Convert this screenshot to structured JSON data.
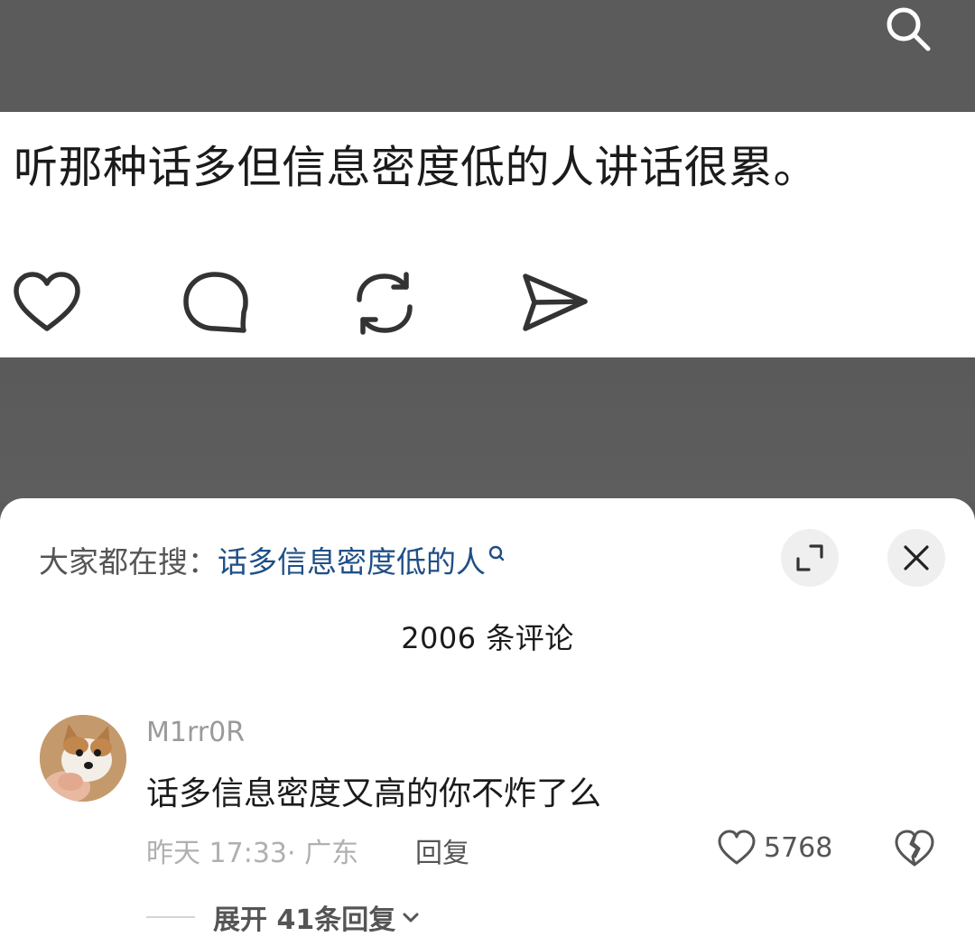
{
  "topbar": {
    "search_icon": "search-icon"
  },
  "post": {
    "text": "听那种话多但信息密度低的人讲话很累。",
    "actions": [
      "like-icon",
      "comment-icon",
      "repost-icon",
      "share-icon"
    ]
  },
  "sheet": {
    "trending_label": "大家都在搜：",
    "trending_query": "话多信息密度低的人",
    "comment_count_title": "2006 条评论",
    "comments": [
      {
        "username": "M1rr0R",
        "text": "话多信息密度又高的你不炸了么",
        "time_location": "昨天 17:33· 广东",
        "reply_label": "回复",
        "likes": "5768",
        "expand_replies_label": "展开 41条回复"
      }
    ]
  },
  "colors": {
    "overlay": "#5b5b5b",
    "link": "#1f4f86",
    "text": "#1b1b1b",
    "muted": "#9a9a9a"
  }
}
